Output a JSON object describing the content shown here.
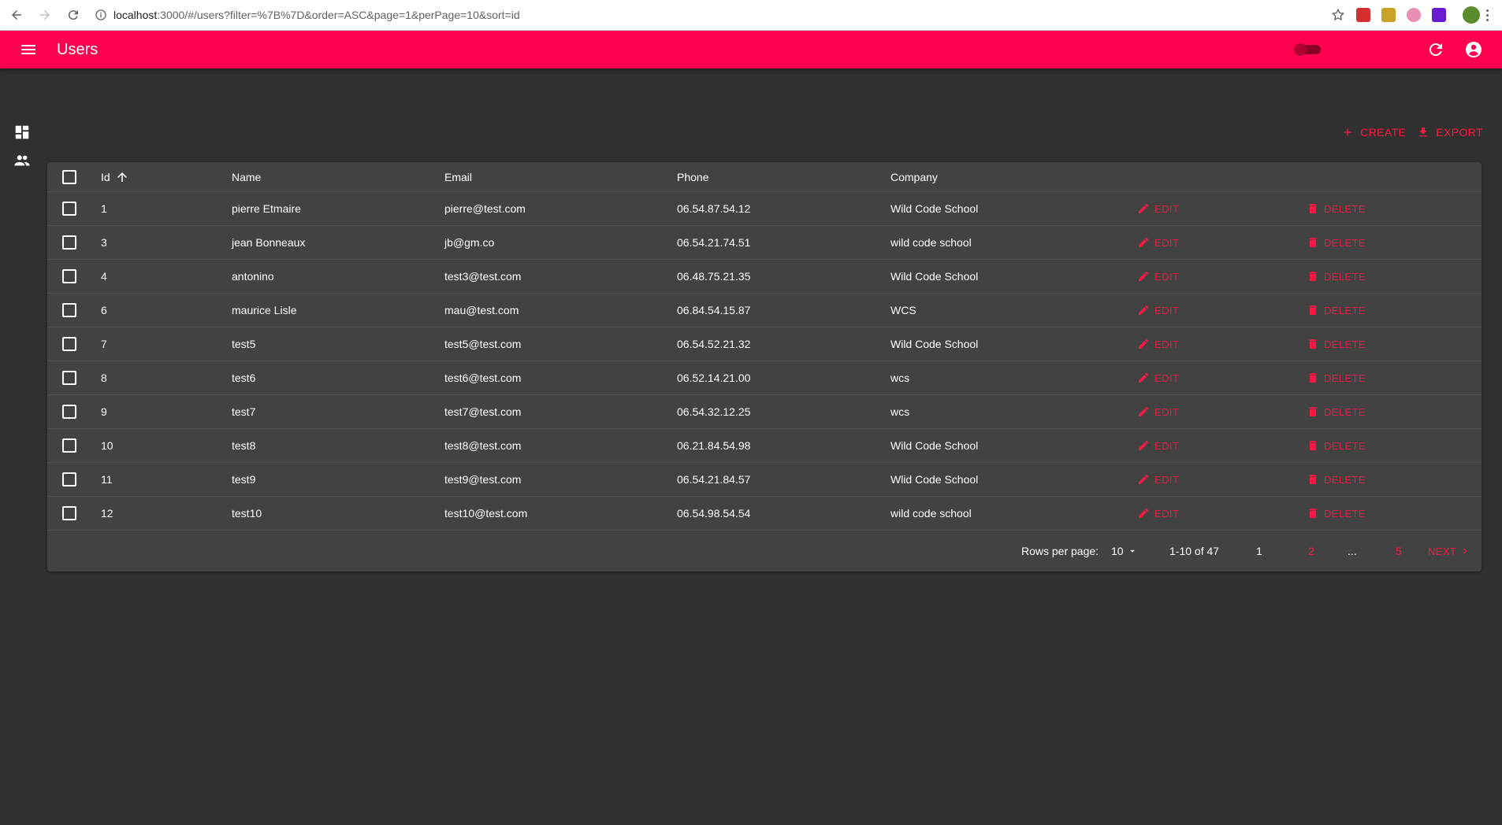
{
  "browser": {
    "url_host": "localhost",
    "url_rest": ":3000/#/users?filter=%7B%7D&order=ASC&page=1&perPage=10&sort=id"
  },
  "app": {
    "title": "Users",
    "accent_color": "#ff0050"
  },
  "actions": {
    "create_label": "CREATE",
    "export_label": "EXPORT"
  },
  "table": {
    "headers": {
      "id": "Id",
      "name": "Name",
      "email": "Email",
      "phone": "Phone",
      "company": "Company"
    },
    "sort": {
      "field": "id",
      "order": "ASC"
    },
    "edit_label": "EDIT",
    "delete_label": "DELETE",
    "rows": [
      {
        "id": "1",
        "name": "pierre Etmaire",
        "email": "pierre@test.com",
        "phone": "06.54.87.54.12",
        "company": "Wild Code School"
      },
      {
        "id": "3",
        "name": "jean Bonneaux",
        "email": "jb@gm.co",
        "phone": "06.54.21.74.51",
        "company": "wild code school"
      },
      {
        "id": "4",
        "name": "antonino",
        "email": "test3@test.com",
        "phone": "06.48.75.21.35",
        "company": "Wild Code School"
      },
      {
        "id": "6",
        "name": "maurice Lisle",
        "email": "mau@test.com",
        "phone": "06.84.54.15.87",
        "company": "WCS"
      },
      {
        "id": "7",
        "name": "test5",
        "email": "test5@test.com",
        "phone": "06.54.52.21.32",
        "company": "Wild Code School"
      },
      {
        "id": "8",
        "name": "test6",
        "email": "test6@test.com",
        "phone": "06.52.14.21.00",
        "company": "wcs"
      },
      {
        "id": "9",
        "name": "test7",
        "email": "test7@test.com",
        "phone": "06.54.32.12.25",
        "company": "wcs"
      },
      {
        "id": "10",
        "name": "test8",
        "email": "test8@test.com",
        "phone": "06.21.84.54.98",
        "company": "Wild Code School"
      },
      {
        "id": "11",
        "name": "test9",
        "email": "test9@test.com",
        "phone": "06.54.21.84.57",
        "company": "Wlid Code School"
      },
      {
        "id": "12",
        "name": "test10",
        "email": "test10@test.com",
        "phone": "06.54.98.54.54",
        "company": "wild code school"
      }
    ]
  },
  "pagination": {
    "rows_per_page_label": "Rows per page:",
    "rows_per_page_value": "10",
    "range": "1-10 of 47",
    "pages": [
      "1",
      "2",
      "...",
      "5"
    ],
    "current_page": "1",
    "next_label": "NEXT"
  }
}
